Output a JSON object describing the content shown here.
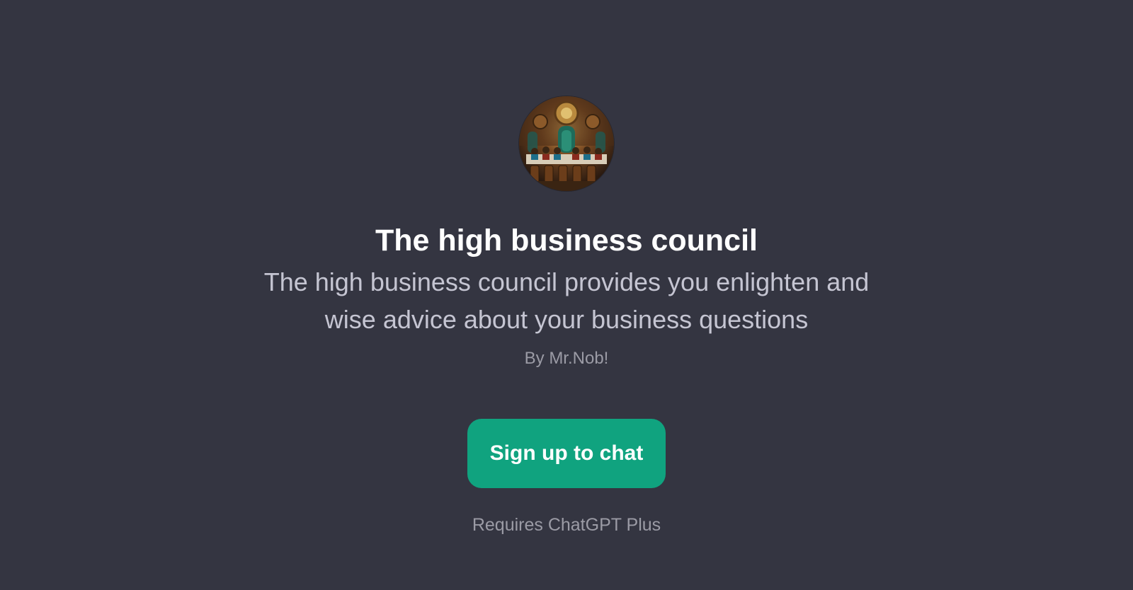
{
  "gpt": {
    "title": "The high business council",
    "description": "The high business council provides you enlighten and wise advice about your business questions",
    "author": "By Mr.Nob!"
  },
  "actions": {
    "signup_label": "Sign up to chat"
  },
  "footer": {
    "requirement": "Requires ChatGPT Plus"
  },
  "colors": {
    "background": "#343541",
    "accent": "#10a37f",
    "title": "#ffffff",
    "description": "#c5c5d2",
    "muted": "#9b9ba5"
  },
  "icons": {
    "avatar": "council-hall-painting"
  }
}
